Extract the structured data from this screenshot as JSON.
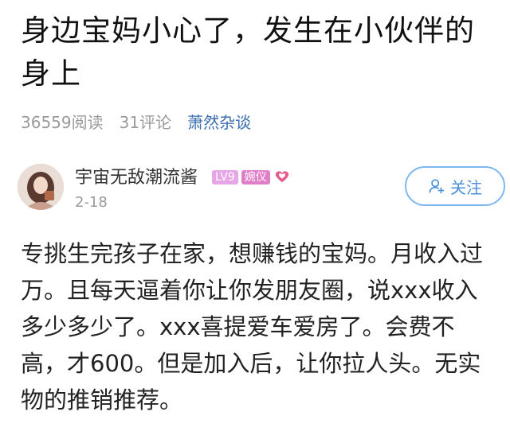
{
  "article": {
    "title": "身边宝妈小心了，发生在小伙伴的身上",
    "read_count": "36559阅读",
    "comment_count": "31评论",
    "source": "萧然杂谈"
  },
  "author": {
    "name": "宇宙无敌潮流酱",
    "level_badge": "LV9",
    "title_badge": "婉仪",
    "post_date": "2-18",
    "follow_label": "关注"
  },
  "post": {
    "content": "专挑生完孩子在家，想赚钱的宝妈。月收入过万。且每天逼着你让你发朋友圈，说xxx收入多少多少了。xxx喜提爱车爱房了。会费不高，才600。但是加入后，让你拉人头。无实物的推销推荐。"
  },
  "colors": {
    "accent_blue": "#4a8fdc",
    "badge_pink": "#e07fc9",
    "meta_gray": "#9a9a9a"
  }
}
